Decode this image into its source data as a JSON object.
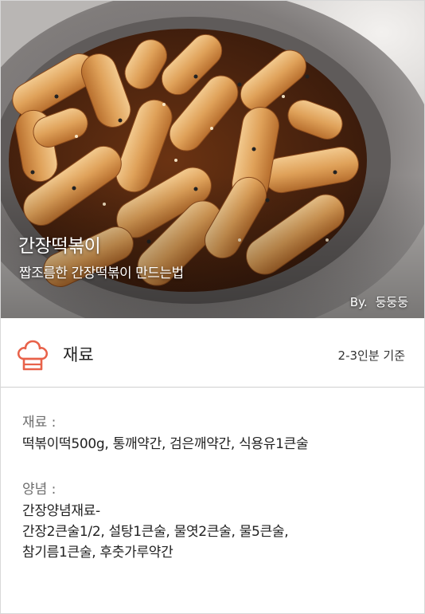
{
  "hero": {
    "title": "간장떡볶이",
    "subtitle": "짭조름한 간장떡볶이 만드는법",
    "author_prefix": "By.",
    "author_name": "둥둥둥"
  },
  "section": {
    "icon": "chef-hat-icon",
    "title": "재료",
    "servings": "2-3인분 기준",
    "accent_color": "#e8624a"
  },
  "ingredients": {
    "label": "재료 :",
    "text": "떡볶이떡500g, 통깨약간, 검은깨약간, 식용유1큰술"
  },
  "sauce": {
    "label": "양념 :",
    "lines": [
      "간장양념재료-",
      "간장2큰술1/2, 설탕1큰술, 물엿2큰술, 물5큰술,",
      "참기름1큰술, 후춧가루약간"
    ]
  }
}
